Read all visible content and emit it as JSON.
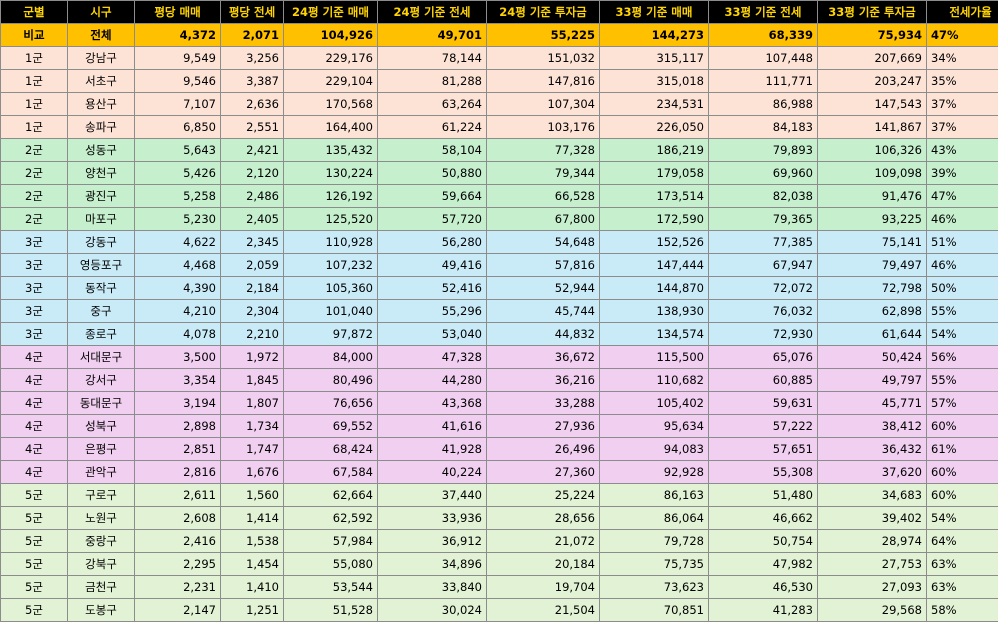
{
  "headers": [
    "군별",
    "시구",
    "평당 매매",
    "평당 전세",
    "24평 기준 매매",
    "24평 기준 전세",
    "24평 기준 투자금",
    "33평 기준 매매",
    "33평 기준 전세",
    "33평 기준 투자금",
    "전세가율"
  ],
  "compare": [
    "비교",
    "전체",
    "4,372",
    "2,071",
    "104,926",
    "49,701",
    "55,225",
    "144,273",
    "68,339",
    "75,934",
    "47%"
  ],
  "rows": [
    [
      "1군",
      "강남구",
      "9,549",
      "3,256",
      "229,176",
      "78,144",
      "151,032",
      "315,117",
      "107,448",
      "207,669",
      "34%"
    ],
    [
      "1군",
      "서초구",
      "9,546",
      "3,387",
      "229,104",
      "81,288",
      "147,816",
      "315,018",
      "111,771",
      "203,247",
      "35%"
    ],
    [
      "1군",
      "용산구",
      "7,107",
      "2,636",
      "170,568",
      "63,264",
      "107,304",
      "234,531",
      "86,988",
      "147,543",
      "37%"
    ],
    [
      "1군",
      "송파구",
      "6,850",
      "2,551",
      "164,400",
      "61,224",
      "103,176",
      "226,050",
      "84,183",
      "141,867",
      "37%"
    ],
    [
      "2군",
      "성동구",
      "5,643",
      "2,421",
      "135,432",
      "58,104",
      "77,328",
      "186,219",
      "79,893",
      "106,326",
      "43%"
    ],
    [
      "2군",
      "양천구",
      "5,426",
      "2,120",
      "130,224",
      "50,880",
      "79,344",
      "179,058",
      "69,960",
      "109,098",
      "39%"
    ],
    [
      "2군",
      "광진구",
      "5,258",
      "2,486",
      "126,192",
      "59,664",
      "66,528",
      "173,514",
      "82,038",
      "91,476",
      "47%"
    ],
    [
      "2군",
      "마포구",
      "5,230",
      "2,405",
      "125,520",
      "57,720",
      "67,800",
      "172,590",
      "79,365",
      "93,225",
      "46%"
    ],
    [
      "3군",
      "강동구",
      "4,622",
      "2,345",
      "110,928",
      "56,280",
      "54,648",
      "152,526",
      "77,385",
      "75,141",
      "51%"
    ],
    [
      "3군",
      "영등포구",
      "4,468",
      "2,059",
      "107,232",
      "49,416",
      "57,816",
      "147,444",
      "67,947",
      "79,497",
      "46%"
    ],
    [
      "3군",
      "동작구",
      "4,390",
      "2,184",
      "105,360",
      "52,416",
      "52,944",
      "144,870",
      "72,072",
      "72,798",
      "50%"
    ],
    [
      "3군",
      "중구",
      "4,210",
      "2,304",
      "101,040",
      "55,296",
      "45,744",
      "138,930",
      "76,032",
      "62,898",
      "55%"
    ],
    [
      "3군",
      "종로구",
      "4,078",
      "2,210",
      "97,872",
      "53,040",
      "44,832",
      "134,574",
      "72,930",
      "61,644",
      "54%"
    ],
    [
      "4군",
      "서대문구",
      "3,500",
      "1,972",
      "84,000",
      "47,328",
      "36,672",
      "115,500",
      "65,076",
      "50,424",
      "56%"
    ],
    [
      "4군",
      "강서구",
      "3,354",
      "1,845",
      "80,496",
      "44,280",
      "36,216",
      "110,682",
      "60,885",
      "49,797",
      "55%"
    ],
    [
      "4군",
      "동대문구",
      "3,194",
      "1,807",
      "76,656",
      "43,368",
      "33,288",
      "105,402",
      "59,631",
      "45,771",
      "57%"
    ],
    [
      "4군",
      "성북구",
      "2,898",
      "1,734",
      "69,552",
      "41,616",
      "27,936",
      "95,634",
      "57,222",
      "38,412",
      "60%"
    ],
    [
      "4군",
      "은평구",
      "2,851",
      "1,747",
      "68,424",
      "41,928",
      "26,496",
      "94,083",
      "57,651",
      "36,432",
      "61%"
    ],
    [
      "4군",
      "관악구",
      "2,816",
      "1,676",
      "67,584",
      "40,224",
      "27,360",
      "92,928",
      "55,308",
      "37,620",
      "60%"
    ],
    [
      "5군",
      "구로구",
      "2,611",
      "1,560",
      "62,664",
      "37,440",
      "25,224",
      "86,163",
      "51,480",
      "34,683",
      "60%"
    ],
    [
      "5군",
      "노원구",
      "2,608",
      "1,414",
      "62,592",
      "33,936",
      "28,656",
      "86,064",
      "46,662",
      "39,402",
      "54%"
    ],
    [
      "5군",
      "중랑구",
      "2,416",
      "1,538",
      "57,984",
      "36,912",
      "21,072",
      "79,728",
      "50,754",
      "28,974",
      "64%"
    ],
    [
      "5군",
      "강북구",
      "2,295",
      "1,454",
      "55,080",
      "34,896",
      "20,184",
      "75,735",
      "47,982",
      "27,753",
      "63%"
    ],
    [
      "5군",
      "금천구",
      "2,231",
      "1,410",
      "53,544",
      "33,840",
      "19,704",
      "73,623",
      "46,530",
      "27,093",
      "63%"
    ],
    [
      "5군",
      "도봉구",
      "2,147",
      "1,251",
      "51,528",
      "30,024",
      "21,504",
      "70,851",
      "41,283",
      "29,568",
      "58%"
    ]
  ],
  "group_colors": {
    "1군": "#fde2d6",
    "2군": "#c6efce",
    "3군": "#c9ebf8",
    "4군": "#f1cff0",
    "5군": "#e2f2d4"
  },
  "header_colors": {
    "background": "#000000",
    "text": "#ffd400",
    "compare_row": "#ffc000"
  }
}
